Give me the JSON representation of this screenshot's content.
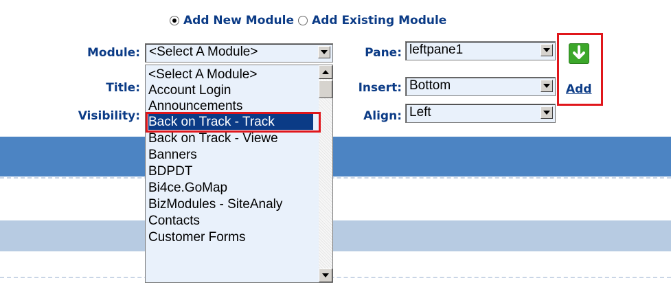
{
  "mode": {
    "add_new_label": "Add New Module",
    "add_existing_label": "Add Existing Module",
    "selected": "Add New Module"
  },
  "labels": {
    "module": "Module:",
    "title": "Title:",
    "visibility": "Visibility:",
    "pane": "Pane:",
    "insert": "Insert:",
    "align": "Align:"
  },
  "module_select": {
    "value": "<Select A Module>",
    "options": [
      "<Select A Module>",
      "Account Login",
      "Announcements",
      "Back on Track - Track",
      "Back on Track - Viewe",
      "Banners",
      "BDPDT",
      "Bi4ce.GoMap",
      "BizModules - SiteAnaly",
      "Contacts",
      "Customer Forms"
    ],
    "highlighted": "Back on Track - Track"
  },
  "pane_select": {
    "value": "leftpane1"
  },
  "insert_select": {
    "value": "Bottom"
  },
  "align_select": {
    "value": "Left"
  },
  "add_action": {
    "label": "Add",
    "icon": "green-down-arrow-icon"
  },
  "colors": {
    "label_text": "#0b3b86",
    "band_blue": "#4c84c3",
    "band_light": "#b7cbe2",
    "highlight": "#0b3b86",
    "annotation_red": "#e0161b",
    "add_icon_green": "#3ca72a"
  }
}
